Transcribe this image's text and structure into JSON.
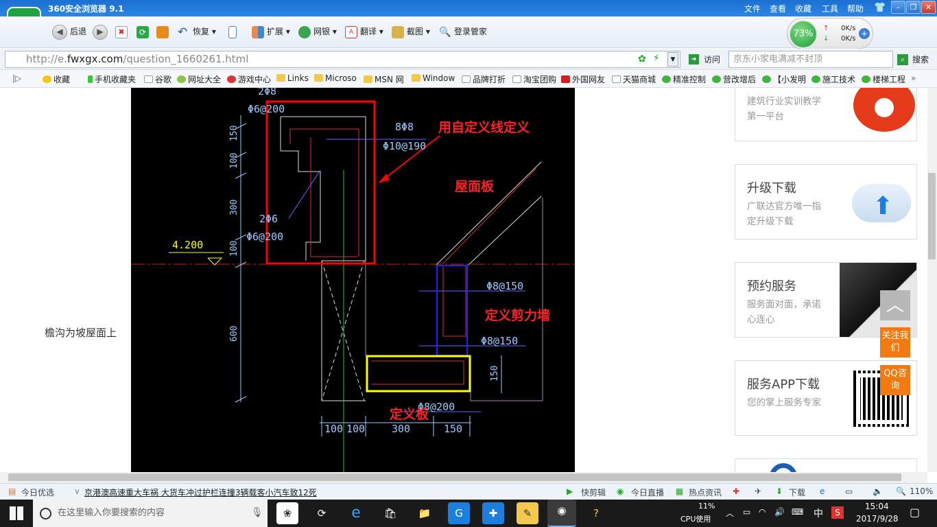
{
  "browser": {
    "title": "360安全浏览器 9.1",
    "menus": [
      "文件",
      "查看",
      "收藏",
      "工具",
      "帮助"
    ],
    "logo_glyph": "e"
  },
  "toolbar": {
    "back": "后退",
    "restore": "恢复",
    "extend": "扩展",
    "bank": "网银",
    "translate": "翻译",
    "screenshot": "截图",
    "manager": "登录管家"
  },
  "speed": {
    "percent": "73%",
    "up": "0K/s",
    "down": "0K/s"
  },
  "address": {
    "url_prefix": "http://e.",
    "url_domain": "fwxgx.com",
    "url_path": "/question_1660261.html",
    "visit": "访问",
    "search_placeholder": "京东小家电满减不封顶",
    "search_button": "搜索"
  },
  "bookmarks": [
    {
      "label": "收藏",
      "icon": "star-icon"
    },
    {
      "label": "手机收藏夹",
      "icon": "phone-icon"
    },
    {
      "label": "谷歌",
      "icon": "page-icon"
    },
    {
      "label": "网址大全",
      "icon": "globe-icon"
    },
    {
      "label": "游戏中心",
      "icon": "game-icon"
    },
    {
      "label": "Links",
      "icon": "folder-icon"
    },
    {
      "label": "Microso",
      "icon": "folder-icon"
    },
    {
      "label": "MSN 网",
      "icon": "folder-icon"
    },
    {
      "label": "Window",
      "icon": "folder-icon"
    },
    {
      "label": "品牌打折",
      "icon": "page-icon"
    },
    {
      "label": "淘宝团购",
      "icon": "page-icon"
    },
    {
      "label": "外国网友",
      "icon": "page-icon"
    },
    {
      "label": "天猫商城",
      "icon": "page-icon"
    },
    {
      "label": "精准控制",
      "icon": "chat-icon"
    },
    {
      "label": "营改增后",
      "icon": "chat-icon"
    },
    {
      "label": "【小发明",
      "icon": "chat-icon"
    },
    {
      "label": "施工技术",
      "icon": "chat-icon"
    },
    {
      "label": "楼梯工程",
      "icon": "chat-icon"
    }
  ],
  "page": {
    "caption": "檐沟为坡屋面上",
    "cad": {
      "ann_custom_line": "用自定义线定义",
      "ann_roof": "屋面板",
      "ann_shear": "定义剪力墙",
      "ann_slab": "定义板",
      "elev": "4.200",
      "rebar1": "2Φ8",
      "rebar2": "Φ6@200",
      "rebar3": "8Φ8",
      "rebar4": "Φ10@190",
      "rebar5": "2Φ6",
      "rebar6": "Φ6@200",
      "rebar7": "Φ8@150",
      "rebar8": "Φ8@150",
      "rebar9": "Φ8@200",
      "dv": [
        "150",
        "100",
        "300",
        "100",
        "600"
      ],
      "dh": [
        "100",
        "100",
        "300",
        "150"
      ],
      "dr": "150"
    },
    "cards": [
      {
        "title": "",
        "desc": "建筑行业实训教学第一平台"
      },
      {
        "title": "升级下载",
        "desc": "广联达官方唯一指定升级下载"
      },
      {
        "title": "预约服务",
        "desc": "服务面对面，承诺心连心"
      },
      {
        "title": "服务APP下载",
        "desc": "您的掌上服务专家"
      }
    ],
    "side_buttons": {
      "follow": "关注我们",
      "qq": "QQ咨询"
    }
  },
  "status": {
    "today": "今日优选",
    "news": "京港澳高速重大车祸 大货车冲过护栏连撞3辆载客小汽车致12死",
    "clip": "快剪辑",
    "live": "今日直播",
    "hot": "热点资讯",
    "download": "下载",
    "zoom": "110%"
  },
  "taskbar": {
    "search_placeholder": "在这里输入你要搜索的内容",
    "cpu_pct": "11%",
    "cpu_label": "CPU使用",
    "ime": "中",
    "time": "15:04",
    "date": "2017/9/28"
  }
}
